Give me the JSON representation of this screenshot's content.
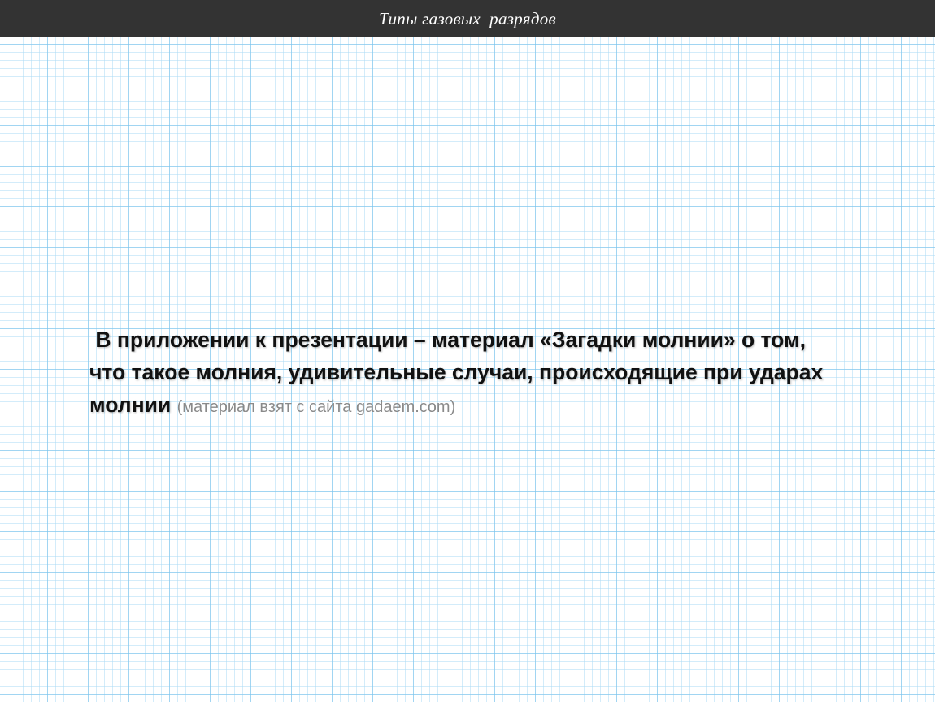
{
  "header": {
    "title": "Типы газовых  разрядов"
  },
  "slide": {
    "body_text": "В приложении к презентации – материал «Загадки молнии» о том, что такое молния, удивительные случаи, происходящие при ударах молнии",
    "source_note": "(материал взят с сайта gadaem.com)"
  },
  "colors": {
    "header_background": "#333333",
    "header_text": "#ffffff",
    "grid_line": "#a8d8f0",
    "body_text": "#111111",
    "source_note_text": "#8a8a8a"
  }
}
